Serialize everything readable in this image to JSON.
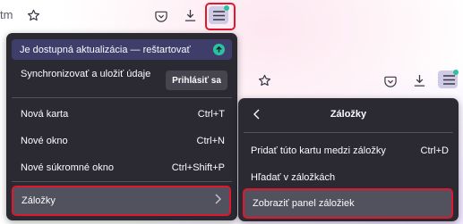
{
  "toolbar_left": {
    "cut_text": "tm",
    "icons": [
      "bookmark-star-icon",
      "pocket-icon",
      "download-icon",
      "app-menu-icon"
    ]
  },
  "main_menu": {
    "update": "Je dostupná aktualizácia — reštartovať",
    "sync_label": "Synchronizovať a uložiť údaje",
    "sign_in": "Prihlásiť sa",
    "items": [
      {
        "label": "Nová karta",
        "shortcut": "Ctrl+T"
      },
      {
        "label": "Nové okno",
        "shortcut": "Ctrl+N"
      },
      {
        "label": "Nové súkromné okno",
        "shortcut": "Ctrl+Shift+P"
      }
    ],
    "bookmarks": "Záložky"
  },
  "bookmarks_menu": {
    "title": "Záložky",
    "items": [
      {
        "label": "Pridať túto kartu medzi záložky",
        "shortcut": "Ctrl+D"
      },
      {
        "label": "Hľadať v záložkách",
        "shortcut": ""
      }
    ],
    "show_toolbar": "Zobraziť panel záložiek"
  },
  "colors": {
    "highlight": "#e0172f",
    "panel_bg": "#2b2a33",
    "update_bg": "#3f3e6b",
    "badge": "#2ac3a2"
  }
}
